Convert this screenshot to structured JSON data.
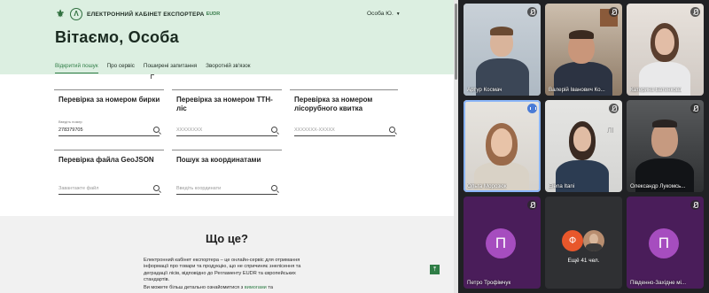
{
  "site": {
    "brand": "ЕЛЕКТРОННИЙ КАБІНЕТ ЕКСПОРТЕРА",
    "brand_suffix": "EUDR",
    "user_menu": "Особа Ю.",
    "welcome": "Вітаємо, Особа",
    "tabs": [
      "Відкритий пошук",
      "Про сервіс",
      "Поширені запитання",
      "Зворотній зв'язок"
    ],
    "cards": [
      {
        "title": "Перевірка за номером бирки",
        "field_label": "Введіть номер",
        "value": "278379705",
        "placeholder": ""
      },
      {
        "title": "Перевірка за номером ТТН-ліс",
        "field_label": "",
        "value": "",
        "placeholder": "XXXXXXXX"
      },
      {
        "title": "Перевірка за номером лісорубного квитка",
        "field_label": "",
        "value": "",
        "placeholder": "XXXXXXX-XXXXX"
      },
      {
        "title": "Перевірка файла GeoJSON",
        "field_label": "",
        "value": "",
        "placeholder": "Завантажте файл"
      },
      {
        "title": "Пошук за координатами",
        "field_label": "",
        "value": "",
        "placeholder": "Введіть координати"
      }
    ],
    "about": {
      "title": "Що це?",
      "body": "Електронний кабінет експортера – це онлайн-сервіс для отримання інформації про товари та продукцію, що не спричиняє знелісення та деградації лісів, відповідно до Регламенту EUDR та європейських стандартів.",
      "more_prefix": "Ви можете більш детально ознайомитися з ",
      "more_link": "вимогами",
      "more_suffix": " та"
    }
  },
  "meeting": {
    "participants": [
      {
        "name": "Артур Космач",
        "muted": true,
        "speaking": false
      },
      {
        "name": "Валерій Іванович Ко...",
        "muted": true,
        "speaking": false
      },
      {
        "name": "Катерина Батенкова",
        "muted": true,
        "speaking": false
      },
      {
        "name": "Ольга Морозюк",
        "muted": false,
        "speaking": true
      },
      {
        "name": "Elena Itani",
        "muted": true,
        "speaking": false
      },
      {
        "name": "Олександр Лукомсь...",
        "muted": true,
        "speaking": false
      },
      {
        "name": "Петро Трофімчук",
        "initial": "П",
        "muted": true,
        "speaking": false
      },
      {
        "name": "Південно-Західне мі...",
        "initial": "П",
        "muted": true,
        "speaking": false
      }
    ],
    "more": {
      "label": "Ещё 41 чел.",
      "initial": "Ф"
    }
  },
  "colors": {
    "accent": "#2f7d46",
    "header_bg": "#dcefe1",
    "meeting_bg": "#202124",
    "avatar_purple": "#a64dbf",
    "active_speaker": "#8ab4f8"
  },
  "icons": [
    "coat-of-arms-icon",
    "logo-icon",
    "chevron-down-icon",
    "search-icon",
    "mic-off-icon",
    "speaking-icon",
    "arrow-up-icon"
  ]
}
